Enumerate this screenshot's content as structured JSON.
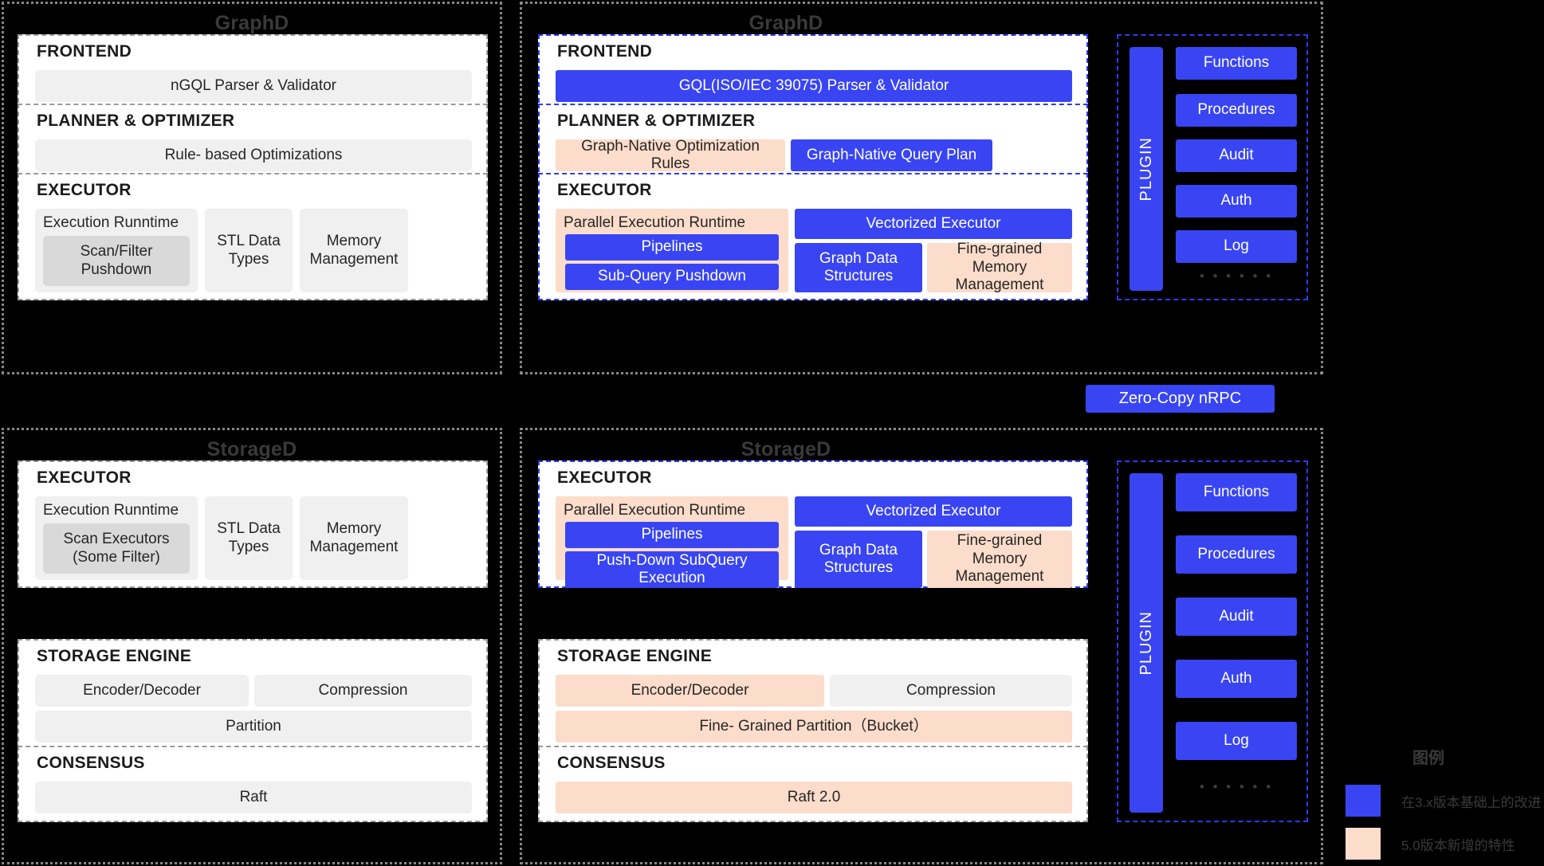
{
  "legend": {
    "title": "图例",
    "items": [
      {
        "color": "#3945f3",
        "label": "在3.x版本基础上的改进"
      },
      {
        "color": "#fcdcca",
        "label": "5.0版本新增的特性"
      }
    ]
  },
  "connector": {
    "label": "Zero-Copy nRPC"
  },
  "plugin": {
    "vertical_label": "PLUGIN",
    "items": [
      "Functions",
      "Procedures",
      "Audit",
      "Auth",
      "Log"
    ],
    "more": "• • • • • •"
  },
  "graphd_old": {
    "title": "GraphD",
    "frontend": {
      "title": "FRONTEND",
      "item": "nGQL Parser & Validator"
    },
    "planner": {
      "title": "PLANNER & OPTIMIZER",
      "item": "Rule- based Optimizations"
    },
    "executor": {
      "title": "EXECUTOR",
      "runtime_label": "Execution Runntime",
      "runtime_child": "Scan/Filter Pushdown",
      "stl": "STL Data Types",
      "memory": "Memory Management"
    }
  },
  "graphd_new": {
    "title": "GraphD",
    "frontend": {
      "title": "FRONTEND",
      "item": "GQL(ISO/IEC 39075) Parser & Validator"
    },
    "planner": {
      "title": "PLANNER & OPTIMIZER",
      "rules": "Graph-Native Optimization Rules",
      "plan": "Graph-Native Query Plan"
    },
    "executor": {
      "title": "EXECUTOR",
      "runtime_label": "Parallel Execution Runtime",
      "pipelines": "Pipelines",
      "subquery": "Sub-Query Pushdown",
      "vectorized": "Vectorized Executor",
      "graph_data": "Graph Data Structures",
      "memory": "Fine-grained Memory Management"
    }
  },
  "storaged_old": {
    "title": "StorageD",
    "executor": {
      "title": "EXECUTOR",
      "runtime_label": "Execution Runntime",
      "runtime_child": "Scan Executors (Some Filter)",
      "stl": "STL Data Types",
      "memory": "Memory Management"
    },
    "storage_engine": {
      "title": "STORAGE ENGINE",
      "encoder": "Encoder/Decoder",
      "compression": "Compression",
      "partition": "Partition"
    },
    "consensus": {
      "title": "CONSENSUS",
      "item": "Raft"
    }
  },
  "storaged_new": {
    "title": "StorageD",
    "executor": {
      "title": "EXECUTOR",
      "runtime_label": "Parallel Execution Runtime",
      "pipelines": "Pipelines",
      "subquery": "Push-Down SubQuery Execution",
      "vectorized": "Vectorized Executor",
      "graph_data": "Graph Data Structures",
      "memory": "Fine-grained Memory Management"
    },
    "storage_engine": {
      "title": "STORAGE ENGINE",
      "encoder": "Encoder/Decoder",
      "compression": "Compression",
      "partition": "Fine- Grained Partition（Bucket）"
    },
    "consensus": {
      "title": "CONSENSUS",
      "item": "Raft 2.0"
    }
  }
}
